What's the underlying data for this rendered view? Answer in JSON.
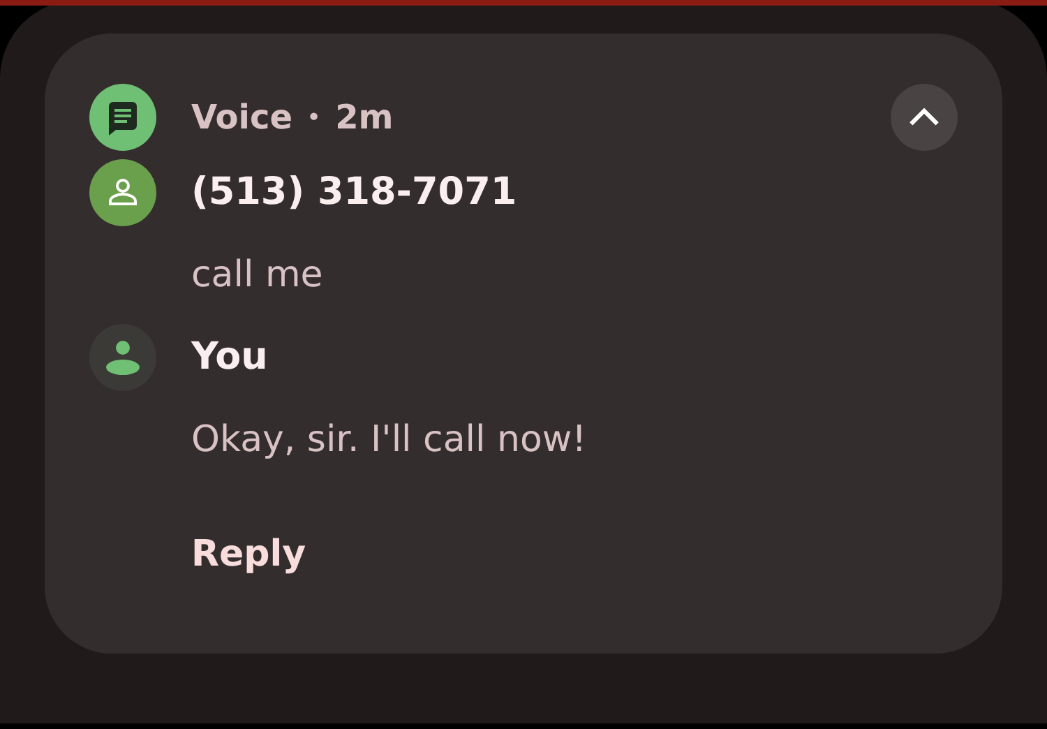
{
  "header": {
    "app": "Voice",
    "separator": "•",
    "time": "2m",
    "expanded": true
  },
  "messages": [
    {
      "sender": "(513) 318-7071",
      "kind": "contact",
      "texts": [
        "call me"
      ]
    },
    {
      "sender": "You",
      "kind": "self",
      "texts": [
        "Okay, sir. I'll call now!"
      ]
    }
  ],
  "actions": [
    "Reply"
  ]
}
